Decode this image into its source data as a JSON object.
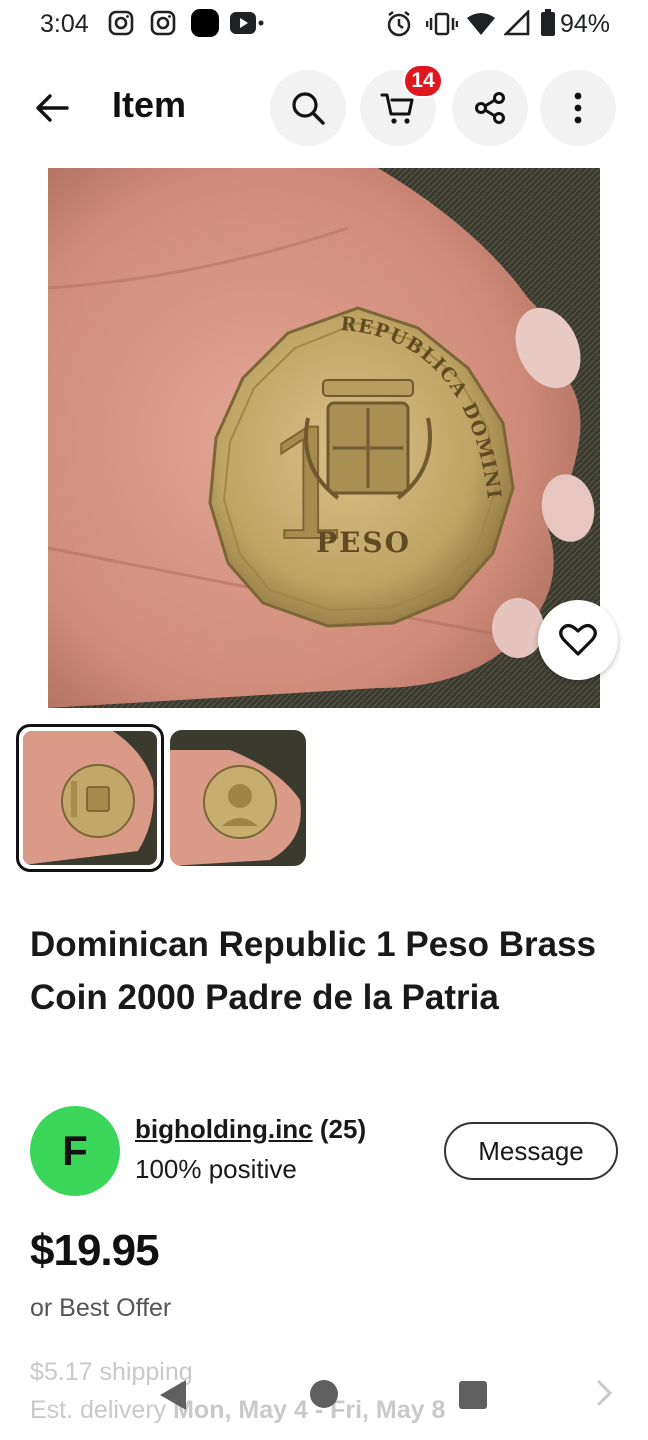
{
  "status_bar": {
    "time": "3:04",
    "battery": "94%"
  },
  "header": {
    "title": "Item",
    "cart_count": "14"
  },
  "item": {
    "title": "Dominican Republic 1 Peso Brass Coin 2000 Padre de la Patria",
    "coin_top_text": "REPUBLICA DOMINICANA",
    "coin_denomination": "PESO",
    "coin_numeral": "1"
  },
  "seller": {
    "initial": "F",
    "name": "bigholding.inc",
    "count": "(25)",
    "feedback": "100% positive",
    "message_label": "Message"
  },
  "pricing": {
    "price": "$19.95",
    "offer": "or Best Offer",
    "shipping": "$5.17 shipping",
    "delivery_prefix": "Est. delivery ",
    "delivery_range": "Mon, May 4 - Fri, May 8"
  },
  "colors": {
    "badge": "#e0171f",
    "avatar": "#3ad65a"
  },
  "icons": [
    "instagram-icon",
    "instagram-icon",
    "app-icon",
    "youtube-icon",
    "alarm-icon",
    "vibrate-icon",
    "wifi-icon",
    "signal-icon",
    "battery-icon",
    "back-arrow-icon",
    "search-icon",
    "cart-icon",
    "share-icon",
    "more-icon",
    "heart-icon"
  ]
}
